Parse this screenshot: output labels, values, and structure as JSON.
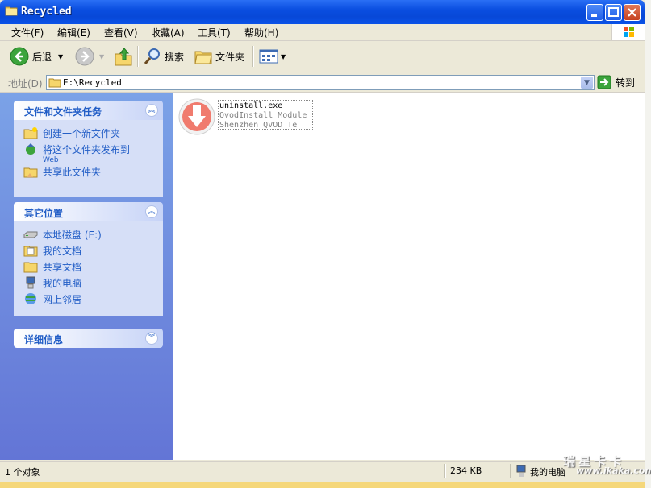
{
  "window": {
    "title": "Recycled"
  },
  "menu": [
    "文件(F)",
    "编辑(E)",
    "查看(V)",
    "收藏(A)",
    "工具(T)",
    "帮助(H)"
  ],
  "toolbar": {
    "back": "后退",
    "search": "搜索",
    "folders": "文件夹"
  },
  "address": {
    "label": "地址(D)",
    "value": "E:\\Recycled",
    "go": "转到"
  },
  "tasks_panel": {
    "title": "文件和文件夹任务",
    "items": [
      {
        "label": "创建一个新文件夹",
        "icon": "new-folder-icon"
      },
      {
        "label": "将这个文件夹发布到",
        "sub": "Web",
        "icon": "publish-web-icon"
      },
      {
        "label": "共享此文件夹",
        "icon": "share-folder-icon"
      }
    ]
  },
  "places_panel": {
    "title": "其它位置",
    "items": [
      {
        "label": "本地磁盘 (E:)",
        "icon": "drive-icon"
      },
      {
        "label": "我的文档",
        "icon": "my-documents-icon"
      },
      {
        "label": "共享文档",
        "icon": "shared-documents-icon"
      },
      {
        "label": "我的电脑",
        "icon": "my-computer-icon"
      },
      {
        "label": "网上邻居",
        "icon": "network-icon"
      }
    ]
  },
  "details_panel": {
    "title": "详细信息"
  },
  "file": {
    "name": "uninstall.exe",
    "line2": "QvodInstall Module",
    "line3": "Shenzhen QVOD Te",
    "icon": "qvod-uninstall-icon"
  },
  "status": {
    "objects": "1 个对象",
    "size": "234 KB",
    "location": "我的电脑"
  },
  "watermark": {
    "line1": "瑞星卡卡",
    "line2": "www.ikaka.com"
  },
  "colors": {
    "title_bar": "#0a4ee0",
    "left_panel": "#7ba2e7",
    "panel_title": "#215dc6"
  }
}
